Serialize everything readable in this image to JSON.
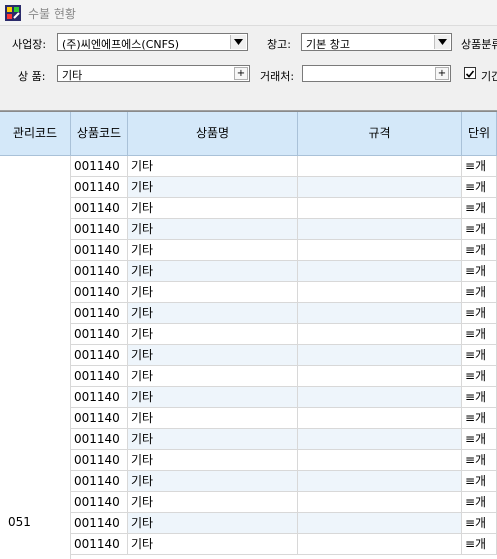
{
  "window": {
    "title": "수불 현황"
  },
  "filters": {
    "workplace_label": "사업장:",
    "workplace_value": "(주)씨엔에프에스(CNFS)",
    "warehouse_label": "창고:",
    "warehouse_value": "기본 창고",
    "category_label": "상품분류",
    "product_label": "상  품:",
    "product_value": "기타",
    "client_label": "거래처:",
    "client_value": "",
    "period_label": "기간",
    "period_checked": true
  },
  "table": {
    "columns": [
      "관리코드",
      "상품코드",
      "상품명",
      "규격",
      "단위"
    ],
    "group_code": "051",
    "rows": [
      {
        "code": "001140",
        "name": "기타",
        "spec": "",
        "unit": "≡개"
      },
      {
        "code": "001140",
        "name": "기타",
        "spec": "",
        "unit": "≡개"
      },
      {
        "code": "001140",
        "name": "기타",
        "spec": "",
        "unit": "≡개"
      },
      {
        "code": "001140",
        "name": "기타",
        "spec": "",
        "unit": "≡개"
      },
      {
        "code": "001140",
        "name": "기타",
        "spec": "",
        "unit": "≡개"
      },
      {
        "code": "001140",
        "name": "기타",
        "spec": "",
        "unit": "≡개"
      },
      {
        "code": "001140",
        "name": "기타",
        "spec": "",
        "unit": "≡개"
      },
      {
        "code": "001140",
        "name": "기타",
        "spec": "",
        "unit": "≡개"
      },
      {
        "code": "001140",
        "name": "기타",
        "spec": "",
        "unit": "≡개"
      },
      {
        "code": "001140",
        "name": "기타",
        "spec": "",
        "unit": "≡개"
      },
      {
        "code": "001140",
        "name": "기타",
        "spec": "",
        "unit": "≡개"
      },
      {
        "code": "001140",
        "name": "기타",
        "spec": "",
        "unit": "≡개"
      },
      {
        "code": "001140",
        "name": "기타",
        "spec": "",
        "unit": "≡개"
      },
      {
        "code": "001140",
        "name": "기타",
        "spec": "",
        "unit": "≡개"
      },
      {
        "code": "001140",
        "name": "기타",
        "spec": "",
        "unit": "≡개"
      },
      {
        "code": "001140",
        "name": "기타",
        "spec": "",
        "unit": "≡개"
      },
      {
        "code": "001140",
        "name": "기타",
        "spec": "",
        "unit": "≡개"
      },
      {
        "code": "001140",
        "name": "기타",
        "spec": "",
        "unit": "≡개"
      },
      {
        "code": "001140",
        "name": "기타",
        "spec": "",
        "unit": "≡개"
      }
    ]
  }
}
